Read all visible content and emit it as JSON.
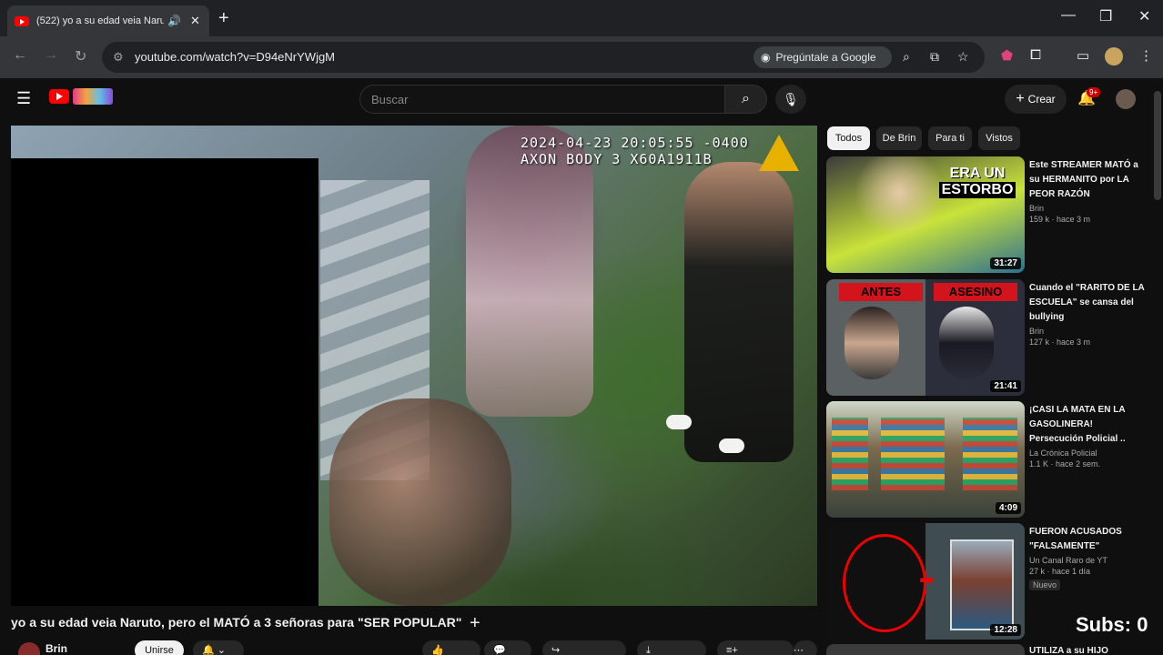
{
  "browser": {
    "tab_title": "(522) yo a su edad veia Naru",
    "url": "youtube.com/watch?v=D94eNrYWjgM",
    "ask_google": "Pregúntale a Google"
  },
  "header": {
    "search_placeholder": "Buscar",
    "create_label": "Crear",
    "notifications": "9+"
  },
  "video": {
    "timestamp": "2024-04-23 20:05:55 -0400",
    "camera_id": "AXON BODY 3 X60A1911B",
    "title": "yo a su edad veia Naruto, pero el MATÓ a 3 señoras para \"SER POPULAR\"",
    "channel": "Brin",
    "join_label": "Unirse"
  },
  "sidebar": {
    "chips": [
      "Todos",
      "De Brin",
      "Para ti",
      "Vistos"
    ],
    "recommendations": [
      {
        "title": "Este STREAMER MATÓ a su HERMANITO por LA PEOR RAZÓN",
        "channel": "Brin",
        "stats": "159 k · hace 3 m",
        "duration": "31:27",
        "thumb_text_1": "ERA UN",
        "thumb_text_2": "ESTORBO"
      },
      {
        "title": "Cuando el \"RARITO DE LA ESCUELA\" se cansa del bullying",
        "channel": "Brin",
        "stats": "127 k · hace 3 m",
        "duration": "21:41",
        "thumb_label_left": "ANTES",
        "thumb_label_right": "ASESINO"
      },
      {
        "title": "¡CASI LA MATA EN LA GASOLINERA! Persecución Policial ..",
        "channel": "La Crónica Policial",
        "stats": "1.1 K · hace 2 sem.",
        "duration": "4:09"
      },
      {
        "title": "FUERON ACUSADOS \"FALSAMENTE\"",
        "channel": "Un Canal Raro de YT",
        "stats": "27 k · hace 1 día",
        "duration": "12:28",
        "badge": "Nuevo"
      },
      {
        "title": "UTILIZA a su HIJO"
      }
    ]
  },
  "overlay": {
    "subs": "Subs: 0"
  }
}
